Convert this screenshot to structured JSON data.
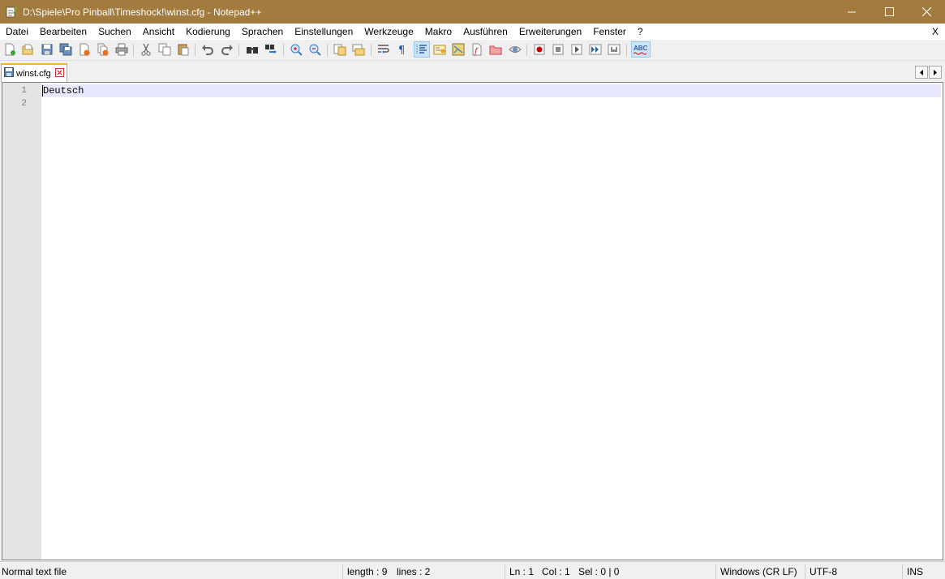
{
  "window": {
    "title": "D:\\Spiele\\Pro Pinball\\Timeshock!\\winst.cfg - Notepad++",
    "app_icon": "notepad-icon",
    "accent_color": "#a27b3f"
  },
  "menu": {
    "items": [
      "Datei",
      "Bearbeiten",
      "Suchen",
      "Ansicht",
      "Kodierung",
      "Sprachen",
      "Einstellungen",
      "Werkzeuge",
      "Makro",
      "Ausführen",
      "Erweiterungen",
      "Fenster",
      "?"
    ],
    "close_label": "X"
  },
  "toolbar": {
    "icons": [
      "new-file-icon",
      "open-file-icon",
      "save-icon",
      "save-all-icon",
      "close-icon",
      "close-all-icon",
      "print-icon",
      "cut-icon",
      "copy-icon",
      "paste-icon",
      "undo-icon",
      "redo-icon",
      "find-icon",
      "replace-icon",
      "zoom-in-icon",
      "zoom-out-icon",
      "sync-vertical-icon",
      "sync-horizontal-icon",
      "word-wrap-icon",
      "show-all-chars-icon",
      "indent-guide-icon",
      "udl-icon",
      "doc-map-icon",
      "function-list-icon",
      "folder-workspace-icon",
      "monitoring-icon",
      "record-macro-icon",
      "stop-macro-icon",
      "play-macro-icon",
      "run-macro-multiple-icon",
      "save-macro-icon",
      "spellcheck-icon"
    ],
    "spellcheck_label": "ABC"
  },
  "tabs": [
    {
      "label": "winst.cfg",
      "active": true
    }
  ],
  "editor": {
    "lines": [
      {
        "number": "1",
        "text": "Deutsch"
      },
      {
        "number": "2",
        "text": ""
      }
    ]
  },
  "status": {
    "file_type": "Normal text file",
    "length": "length : 9",
    "lines": "lines : 2",
    "ln": "Ln : 1",
    "col": "Col : 1",
    "sel": "Sel : 0 | 0",
    "eol": "Windows (CR LF)",
    "encoding": "UTF-8",
    "mode": "INS"
  }
}
